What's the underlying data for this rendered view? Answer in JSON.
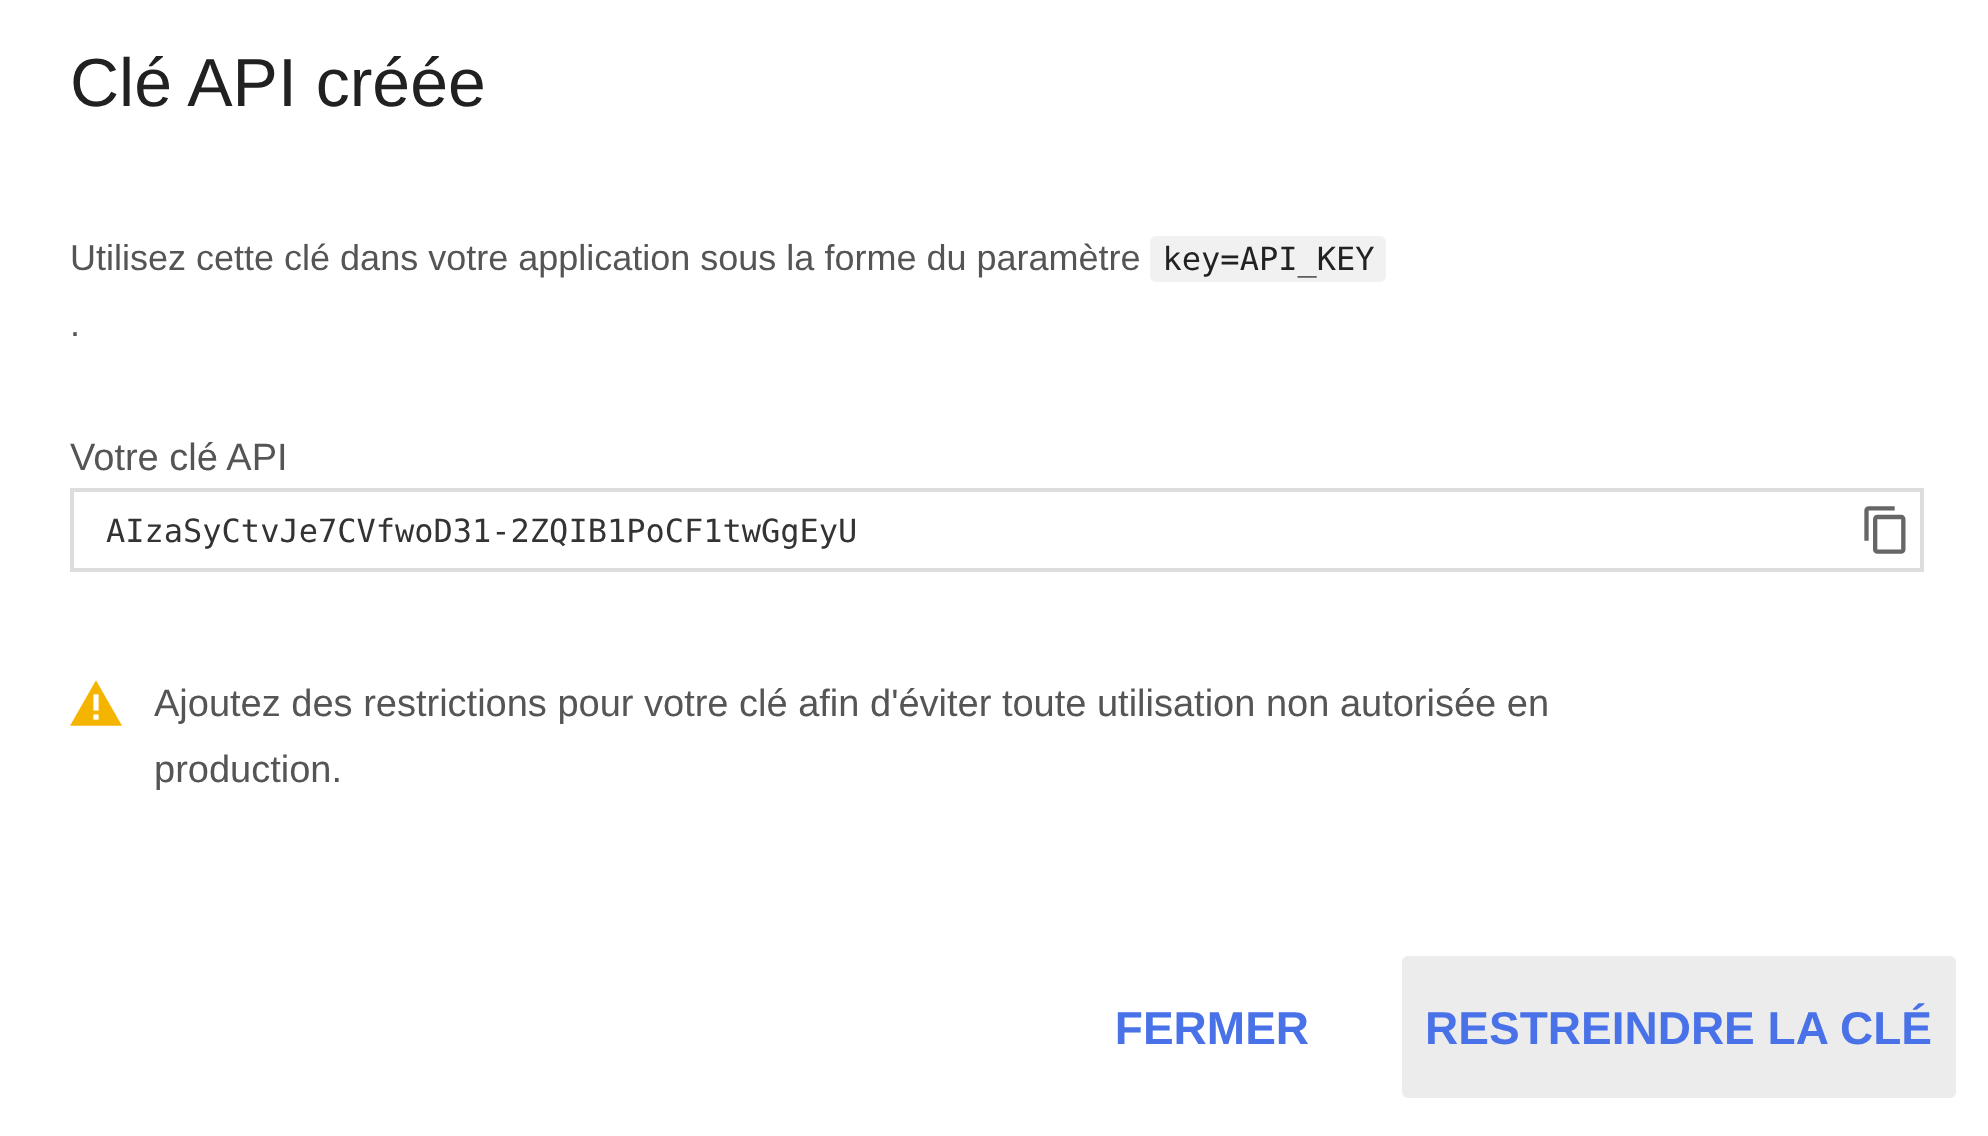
{
  "dialog": {
    "title": "Clé API créée",
    "description": {
      "text": "Utilisez cette clé dans votre application sous la forme du paramètre",
      "code": "key=API_KEY",
      "suffix": "."
    },
    "key_field": {
      "label": "Votre clé API",
      "value": "AIzaSyCtvJe7CVfwoD31-2ZQIB1PoCF1twGgEyU"
    },
    "warning": "Ajoutez des restrictions pour votre clé afin d'éviter toute utilisation non autorisée en production.",
    "buttons": [
      {
        "label": "FERMER",
        "focused": false
      },
      {
        "label": "RESTREINDRE LA CLÉ",
        "focused": true
      }
    ]
  }
}
